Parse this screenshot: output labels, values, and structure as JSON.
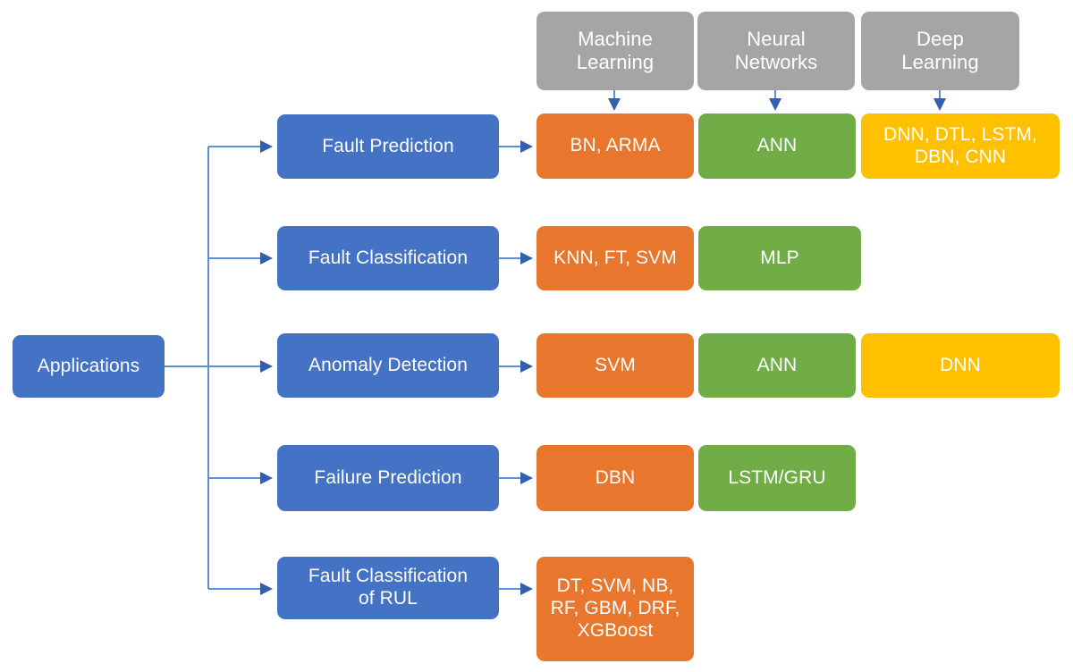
{
  "diagram": {
    "title": "Applications",
    "colors": {
      "blue": "#4472C4",
      "gray": "#A5A5A5",
      "orange": "#E8762C",
      "green": "#70AD47",
      "yellow": "#FFC000",
      "connector": "#5B8FD6",
      "background": "#FFFFFF"
    },
    "root": {
      "label": "Applications"
    },
    "headers": [
      {
        "label": "Machine\nLearning",
        "key": "machine-learning"
      },
      {
        "label": "Neural\nNetworks",
        "key": "neural-networks"
      },
      {
        "label": "Deep\nLearning",
        "key": "deep-learning"
      }
    ],
    "rows": [
      {
        "application": "Fault Prediction",
        "machine_learning": "BN, ARMA",
        "neural_networks": "ANN",
        "deep_learning": "DNN, DTL, LSTM,\nDBN, CNN"
      },
      {
        "application": "Fault Classification",
        "machine_learning": "KNN, FT, SVM",
        "neural_networks": "MLP",
        "deep_learning": null
      },
      {
        "application": "Anomaly Detection",
        "machine_learning": "SVM",
        "neural_networks": "ANN",
        "deep_learning": "DNN"
      },
      {
        "application": "Failure Prediction",
        "machine_learning": "DBN",
        "neural_networks": "LSTM/GRU",
        "deep_learning": null
      },
      {
        "application": "Fault Classification\nof RUL",
        "machine_learning": "DT, SVM, NB,\nRF, GBM, DRF,\nXGBoost",
        "neural_networks": null,
        "deep_learning": null
      }
    ]
  }
}
